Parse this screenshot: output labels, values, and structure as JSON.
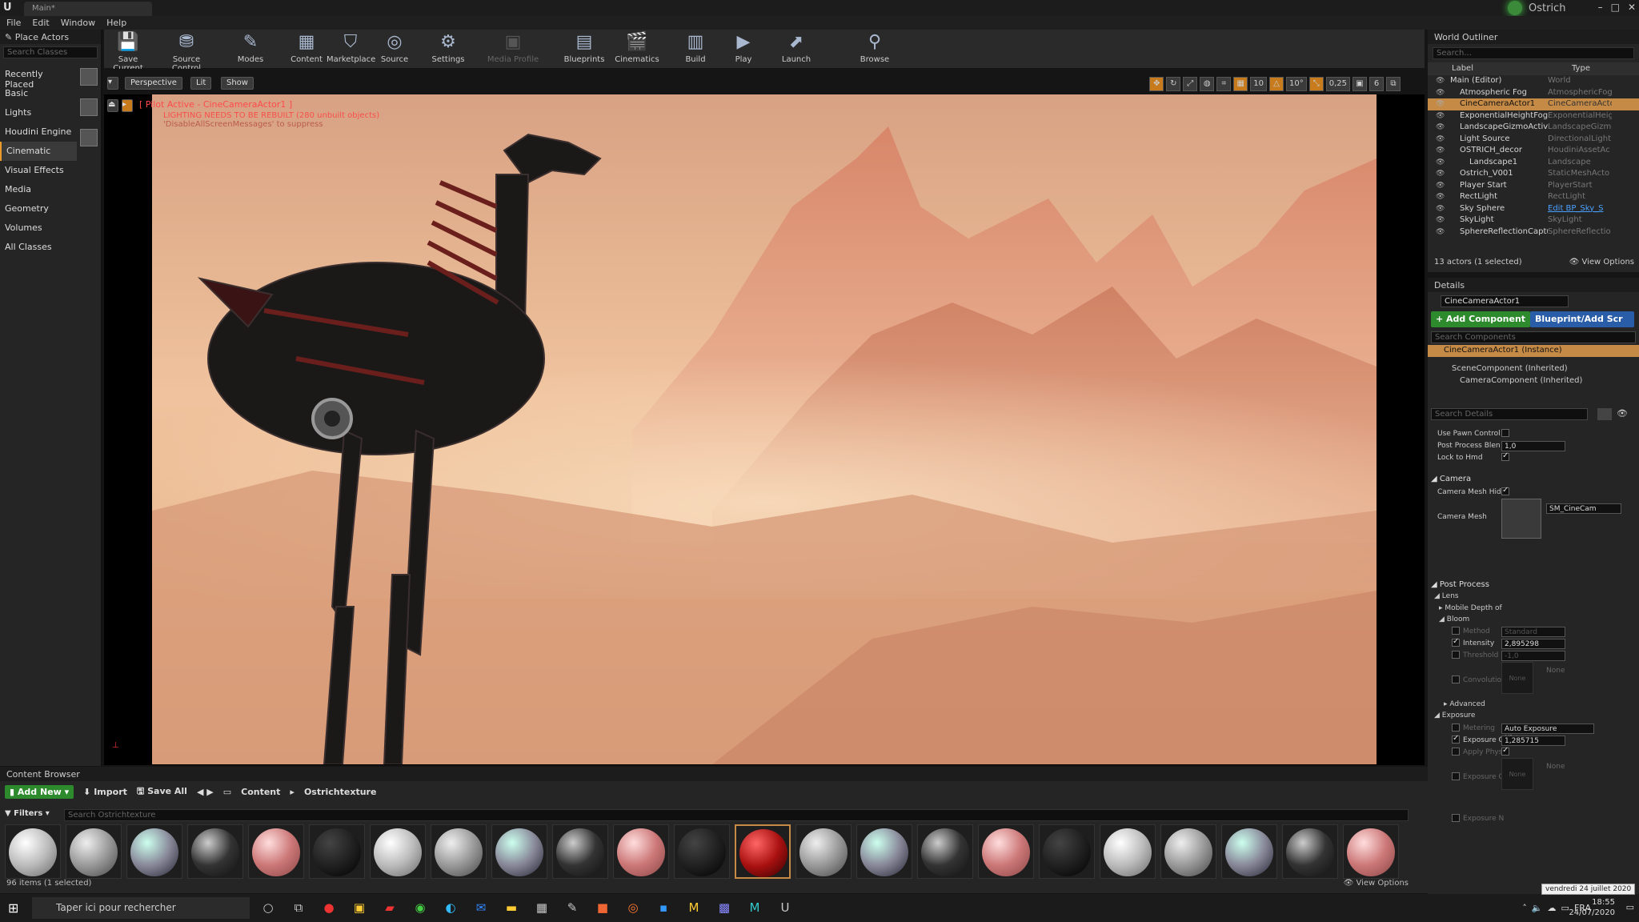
{
  "window": {
    "tab_title": "Main*",
    "project_name": "Ostrich",
    "logo": "U"
  },
  "menu": [
    "File",
    "Edit",
    "Window",
    "Help"
  ],
  "place_actors": {
    "title": "Place Actors",
    "search_placeholder": "Search Classes",
    "categories": [
      "Recently Placed",
      "Basic",
      "Lights",
      "Houdini Engine",
      "Cinematic",
      "Visual Effects",
      "Media",
      "Geometry",
      "Volumes",
      "All Classes"
    ],
    "active_category": "Cinematic"
  },
  "toolbar": {
    "buttons": [
      {
        "label": "Save Current",
        "icon": "save-icon"
      },
      {
        "label": "Source Control",
        "icon": "source-control-icon"
      },
      {
        "label": "Modes",
        "icon": "modes-icon"
      },
      {
        "label": "Content",
        "icon": "content-icon"
      },
      {
        "label": "Marketplace",
        "icon": "marketplace-icon"
      },
      {
        "label": "Source",
        "icon": "source-icon"
      },
      {
        "label": "Settings",
        "icon": "settings-icon"
      },
      {
        "label": "Media Profile",
        "icon": "media-profile-icon"
      },
      {
        "label": "Blueprints",
        "icon": "blueprints-icon"
      },
      {
        "label": "Cinematics",
        "icon": "cinematics-icon"
      },
      {
        "label": "Build",
        "icon": "build-icon"
      },
      {
        "label": "Play",
        "icon": "play-icon"
      },
      {
        "label": "Launch",
        "icon": "launch-icon"
      },
      {
        "label": "Browse",
        "icon": "browse-icon"
      }
    ]
  },
  "viewport": {
    "perspective": "Perspective",
    "lit": "Lit",
    "show": "Show",
    "pilot_text": "[ Pilot Active - CineCameraActor1 ]",
    "warning_text": "LIGHTING NEEDS TO BE REBUILT (280 unbuilt objects)",
    "suppress_text": "'DisableAllScreenMessages' to suppress",
    "grid_snap": "10",
    "rot_snap": "10°",
    "scale_snap": "0,25",
    "cam_speed": "6"
  },
  "outliner": {
    "title": "World Outliner",
    "search_placeholder": "Search...",
    "col_label": "Label",
    "col_type": "Type",
    "rows": [
      {
        "label": "Main (Editor)",
        "type": "World"
      },
      {
        "label": "Atmospheric Fog",
        "type": "AtmosphericFog"
      },
      {
        "label": "CineCameraActor1",
        "type": "CineCameraActor"
      },
      {
        "label": "ExponentialHeightFog",
        "type": "ExponentialHeig"
      },
      {
        "label": "LandscapeGizmoActiveActor",
        "type": "LandscapeGizmo"
      },
      {
        "label": "Light Source",
        "type": "DirectionalLight"
      },
      {
        "label": "OSTRICH_decor",
        "type": "HoudiniAssetAc"
      },
      {
        "label": "Landscape1",
        "type": "Landscape"
      },
      {
        "label": "Ostrich_V001",
        "type": "StaticMeshActo"
      },
      {
        "label": "Player Start",
        "type": "PlayerStart"
      },
      {
        "label": "RectLight",
        "type": "RectLight"
      },
      {
        "label": "Sky Sphere",
        "type": "Edit BP_Sky_S"
      },
      {
        "label": "SkyLight",
        "type": "SkyLight"
      },
      {
        "label": "SphereReflectionCapture",
        "type": "SphereReflectio"
      }
    ],
    "selected_index": 2,
    "footer": "13 actors (1 selected)",
    "view_options": "View Options"
  },
  "details": {
    "title": "Details",
    "actor_name": "CineCameraActor1",
    "add_component": "+ Add Component",
    "blueprint": "Blueprint/Add Scr",
    "search_components": "Search Components",
    "instance": "CineCameraActor1 (Instance)",
    "scene_component": "SceneComponent (Inherited)",
    "camera_component": "CameraComponent (Inherited)",
    "search_details": "Search Details",
    "use_pawn": "Use Pawn Control I",
    "post_blend": "Post Process Blen",
    "post_blend_val": "1,0",
    "lock_hmd": "Lock to Hmd",
    "camera_section": "Camera",
    "camera_mesh_hidden": "Camera Mesh Hidd",
    "camera_mesh": "Camera Mesh",
    "camera_mesh_val": "SM_CineCam",
    "post_process": "Post Process",
    "lens": "Lens",
    "mobile_dof": "Mobile Depth of",
    "bloom": "Bloom",
    "method": "Method",
    "method_val": "Standard",
    "intensity": "Intensity",
    "intensity_val": "2,895298",
    "threshold": "Threshold",
    "threshold_val": "-1,0",
    "convolution": "Convolutio",
    "none": "None",
    "advanced": "Advanced",
    "exposure": "Exposure",
    "metering": "Metering",
    "metering_val": "Auto Exposure Histogram",
    "exposure_c": "Exposure C",
    "exposure_c_val": "1,285715",
    "apply_phys": "Apply Phys",
    "exposure_c2": "Exposure C",
    "exposure_n": "Exposure N"
  },
  "content_browser": {
    "title": "Content Browser",
    "add_new": "Add New",
    "import": "Import",
    "save_all": "Save All",
    "path_root": "Content",
    "path_folder": "Ostrichtexture",
    "filters": "Filters",
    "search_placeholder": "Search Ostrichtexture",
    "footer": "96 items (1 selected)",
    "view_options": "View Options",
    "thumb_count": 23
  },
  "taskbar": {
    "search_placeholder": "Taper ici pour rechercher",
    "lang": "FRA",
    "time": "18:55",
    "date": "24/07/2020",
    "tooltip": "vendredi 24 juillet 2020"
  }
}
